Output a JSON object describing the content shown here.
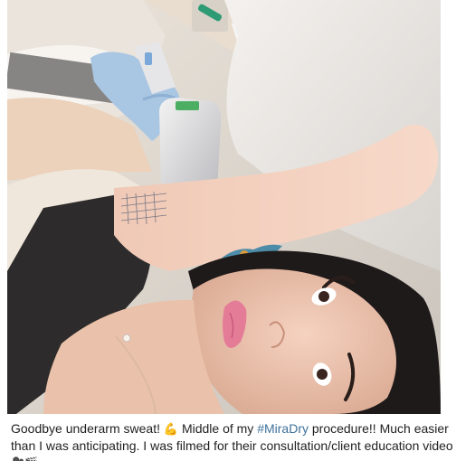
{
  "post": {
    "caption": {
      "text_before_emoji": "Goodbye underarm sweat! ",
      "emoji_muscle": "💪",
      "text_after_emoji": " Middle of my ",
      "hashtag": "#MiraDry",
      "text_after_hashtag": " procedure!! Much easier than I was anticipating. I was filmed for their consultation/client education video ",
      "emoji_end_1": "🎥",
      "emoji_end_2": "🎬"
    }
  }
}
